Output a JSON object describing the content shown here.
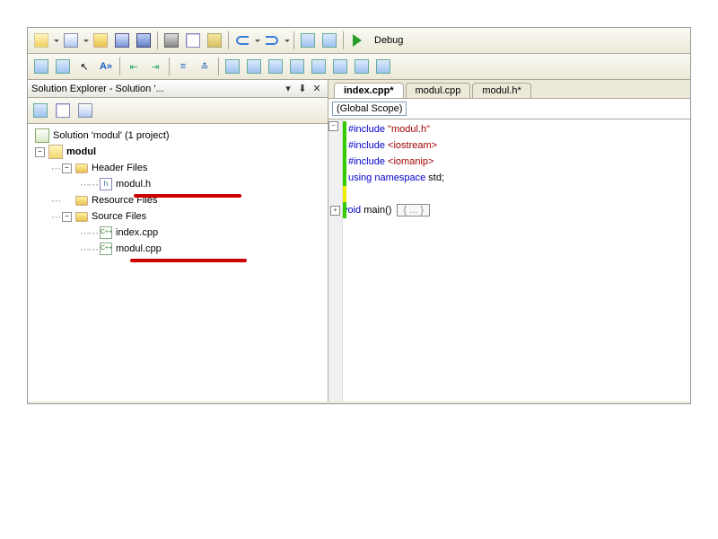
{
  "build_config": "Debug",
  "solution_panel": {
    "title": "Solution Explorer - Solution '...",
    "solution_line": "Solution 'modul' (1 project)",
    "project_name": "modul",
    "header_files_label": "Header Files",
    "resource_files_label": "Resource Files",
    "source_files_label": "Source Files",
    "header_files": {
      "f0": "modul.h"
    },
    "source_files": {
      "f0": "index.cpp",
      "f1": "modul.cpp"
    }
  },
  "tabs": {
    "t0": "index.cpp*",
    "t1": "modul.cpp",
    "t2": "modul.h*"
  },
  "scope": "(Global Scope)",
  "code": {
    "l1a": "#include",
    "l1b": "\"modul.h\"",
    "l2a": "#include",
    "l2b": "<iostream>",
    "l3a": "#include",
    "l3b": "<iomanip>",
    "l4a": "using",
    "l4b": "namespace",
    "l4c": "std",
    "l6a": "void",
    "l6b": "main",
    "l6c": "()",
    "l6d": "{ ... }"
  },
  "icons": {
    "h": "h",
    "cpp": "C++"
  }
}
